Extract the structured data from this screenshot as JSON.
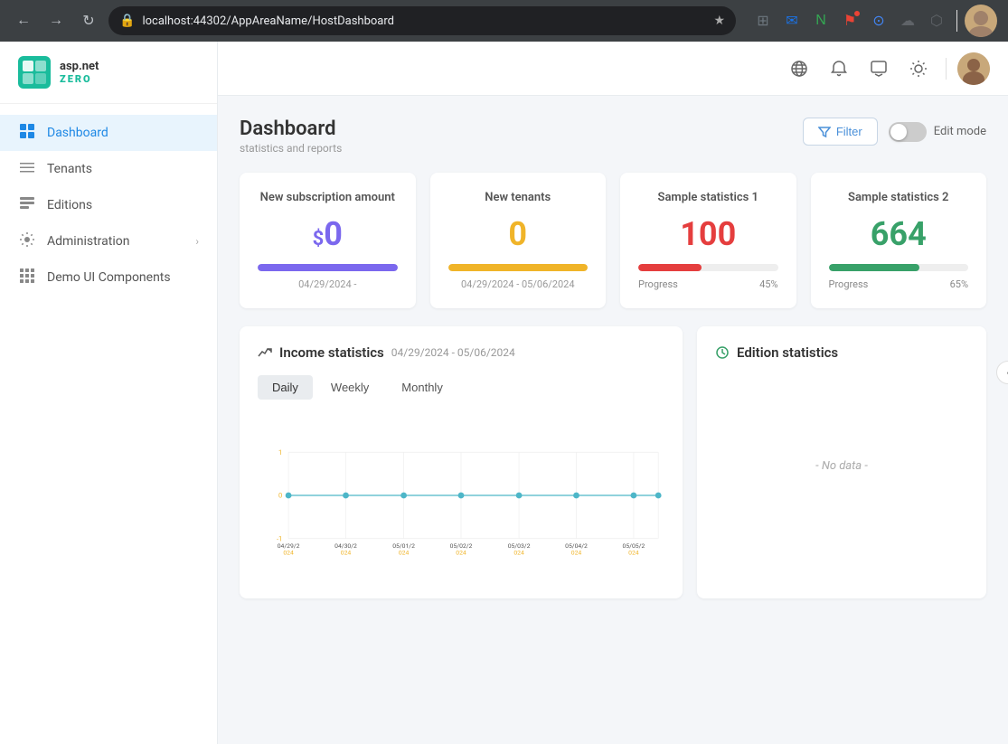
{
  "browser": {
    "url": "localhost:44302/AppAreaName/HostDashboard",
    "back_btn": "←",
    "forward_btn": "→",
    "refresh_btn": "↻"
  },
  "sidebar": {
    "logo": {
      "icon_text": "ASP.NET",
      "text": "asp.net",
      "subtext": "ZERO"
    },
    "items": [
      {
        "id": "dashboard",
        "label": "Dashboard",
        "icon": "⊞",
        "active": true
      },
      {
        "id": "tenants",
        "label": "Tenants",
        "icon": "☰"
      },
      {
        "id": "editions",
        "label": "Editions",
        "icon": "▤"
      },
      {
        "id": "administration",
        "label": "Administration",
        "icon": "⚙",
        "has_chevron": true
      },
      {
        "id": "demo-ui",
        "label": "Demo UI Components",
        "icon": "⊞"
      }
    ]
  },
  "topbar": {
    "icons": [
      "🌐",
      "🔔",
      "💬",
      "☀"
    ]
  },
  "header": {
    "title": "Dashboard",
    "subtitle": "statistics and reports",
    "filter_label": "Filter",
    "edit_mode_label": "Edit mode"
  },
  "stats": [
    {
      "id": "new-subscription",
      "label": "New subscription amount",
      "value": "0",
      "prefix": "$",
      "color": "purple",
      "bar_width": "100%",
      "date": "04/29/2024 -"
    },
    {
      "id": "new-tenants",
      "label": "New tenants",
      "value": "0",
      "color": "yellow",
      "bar_width": "100%",
      "date_range": "04/29/2024 - 05/06/2024"
    },
    {
      "id": "sample-stats-1",
      "label": "Sample statistics 1",
      "value": "100",
      "color": "red",
      "bar_width": "45%",
      "progress_label": "Progress",
      "progress_pct": "45%"
    },
    {
      "id": "sample-stats-2",
      "label": "Sample statistics 2",
      "value": "664",
      "color": "green",
      "bar_width": "65%",
      "progress_label": "Progress",
      "progress_pct": "65%"
    }
  ],
  "income_chart": {
    "title": "Income statistics",
    "date_range": "04/29/2024 - 05/06/2024",
    "tabs": [
      "Daily",
      "Weekly",
      "Monthly"
    ],
    "active_tab": "Daily",
    "x_labels": [
      "04/29/2\n024",
      "04/30/2\n024",
      "05/01/2\n024",
      "05/02/2\n024",
      "05/03/2\n024",
      "05/04/2\n024",
      "05/05/2\n024"
    ],
    "x_labels_short": [
      "04/29/2024",
      "04/30/2024",
      "05/01/2024",
      "05/02/2024",
      "05/03/2024",
      "05/04/2024",
      "05/05/2024"
    ],
    "y_labels": [
      "1",
      "0",
      "-1"
    ],
    "data_points": [
      0,
      0,
      0,
      0,
      0,
      0,
      0,
      0
    ],
    "line_color": "#4db6c8",
    "dot_color": "#4db6c8",
    "y_color": "#f0b429"
  },
  "edition_chart": {
    "title": "Edition statistics",
    "no_data_label": "- No data -"
  }
}
